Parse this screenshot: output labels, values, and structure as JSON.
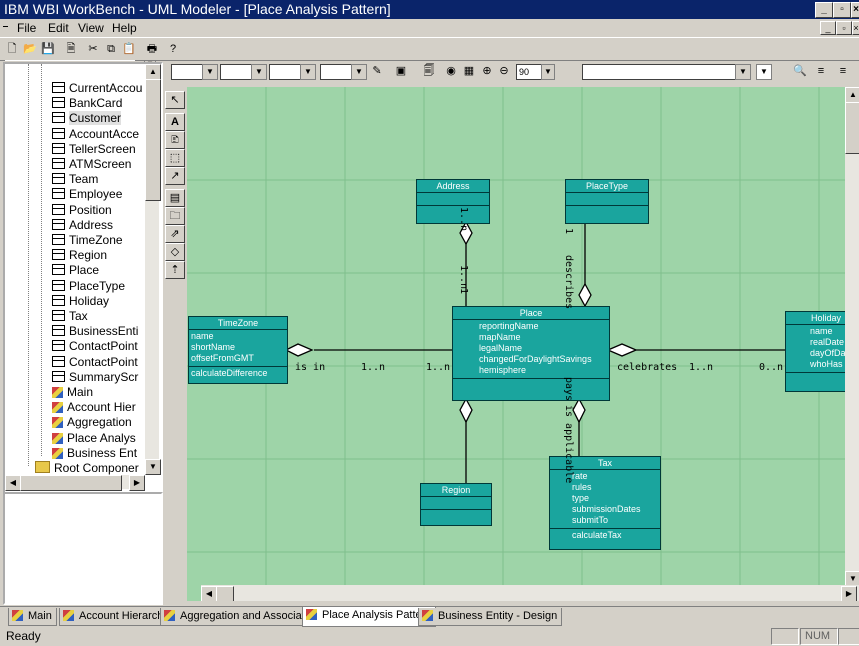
{
  "window": {
    "title": "IBM WBI WorkBench - UML Modeler - [Place Analysis Pattern]",
    "controls": [
      "_",
      "̅",
      "×"
    ],
    "mdi_controls": [
      "_",
      "̅",
      "×"
    ]
  },
  "menu": [
    "File",
    "Edit",
    "View",
    "Help"
  ],
  "toolbar": {
    "zoom_value": "90",
    "icons": [
      "new-icon",
      "open-icon",
      "save-icon",
      "print-preview-icon",
      "cut-icon",
      "copy-icon",
      "paste-icon",
      "print-icon",
      "help-icon"
    ]
  },
  "tree": {
    "items": [
      {
        "label": "CurrentAccou",
        "kind": "class"
      },
      {
        "label": "BankCard",
        "kind": "class"
      },
      {
        "label": "Customer",
        "kind": "class",
        "selected": true
      },
      {
        "label": "AccountAcce",
        "kind": "class"
      },
      {
        "label": "TellerScreen",
        "kind": "class"
      },
      {
        "label": "ATMScreen",
        "kind": "class"
      },
      {
        "label": "Team",
        "kind": "class"
      },
      {
        "label": "Employee",
        "kind": "class"
      },
      {
        "label": "Position",
        "kind": "class"
      },
      {
        "label": "Address",
        "kind": "class"
      },
      {
        "label": "TimeZone",
        "kind": "class"
      },
      {
        "label": "Region",
        "kind": "class"
      },
      {
        "label": "Place",
        "kind": "class"
      },
      {
        "label": "PlaceType",
        "kind": "class"
      },
      {
        "label": "Holiday",
        "kind": "class"
      },
      {
        "label": "Tax",
        "kind": "class"
      },
      {
        "label": "BusinessEnti",
        "kind": "class"
      },
      {
        "label": "ContactPoint",
        "kind": "class"
      },
      {
        "label": "ContactPoint",
        "kind": "class"
      },
      {
        "label": "SummaryScr",
        "kind": "class"
      },
      {
        "label": "Main",
        "kind": "diagram"
      },
      {
        "label": "Account Hier",
        "kind": "diagram"
      },
      {
        "label": "Aggregation",
        "kind": "diagram"
      },
      {
        "label": "Place Analys",
        "kind": "diagram"
      },
      {
        "label": "Business Ent",
        "kind": "diagram"
      },
      {
        "label": "Root Componer",
        "kind": "folder"
      }
    ]
  },
  "palette": [
    "select-tool-icon",
    "text-tool-icon",
    "note-tool-icon",
    "box-tool-icon",
    "line-tool-icon",
    "class-tool-icon",
    "package-tool-icon",
    "generalization-tool-icon",
    "aggregation-tool-icon",
    "dependency-tool-icon"
  ],
  "diagram": {
    "classes": {
      "address": {
        "name": "Address",
        "attributes": [],
        "operations": []
      },
      "placetype": {
        "name": "PlaceType",
        "attributes": [],
        "operations": []
      },
      "timezone": {
        "name": "TimeZone",
        "attributes": [
          "name",
          "shortName",
          "offsetFromGMT"
        ],
        "operations": [
          "calculateDifference"
        ]
      },
      "place": {
        "name": "Place",
        "attributes": [
          "reportingName",
          "mapName",
          "legalName",
          "changedForDaylightSavings",
          "hemisphere"
        ],
        "operations": []
      },
      "holiday": {
        "name": "Holiday",
        "attributes": [
          "name",
          "realDate",
          "dayOfDa",
          "whoHas"
        ],
        "operations": []
      },
      "region": {
        "name": "Region",
        "attributes": [],
        "operations": []
      },
      "tax": {
        "name": "Tax",
        "attributes": [
          "rate",
          "rules",
          "type",
          "submissionDates",
          "submitTo"
        ],
        "operations": [
          "calculateTax"
        ]
      }
    },
    "labels": {
      "is_in": "is in",
      "tz_mult": "1..n",
      "place_tz_mult": "1..n",
      "celebrates": "celebrates",
      "hol_mult1": "1..n",
      "hol_mult2": "0..n",
      "addr_mult": "1..n",
      "addr_one": "1",
      "pt_one": "1",
      "describes": "describes",
      "pays": "pays",
      "applicable": "is applicable"
    }
  },
  "tabs": [
    {
      "label": "Main",
      "active": false
    },
    {
      "label": "Account Hierarchy",
      "active": false
    },
    {
      "label": "Aggregation and Association",
      "active": false
    },
    {
      "label": "Place Analysis Pattern",
      "active": true
    },
    {
      "label": "Business Entity - Design",
      "active": false
    }
  ],
  "status": {
    "text": "Ready",
    "num": "NUM"
  }
}
